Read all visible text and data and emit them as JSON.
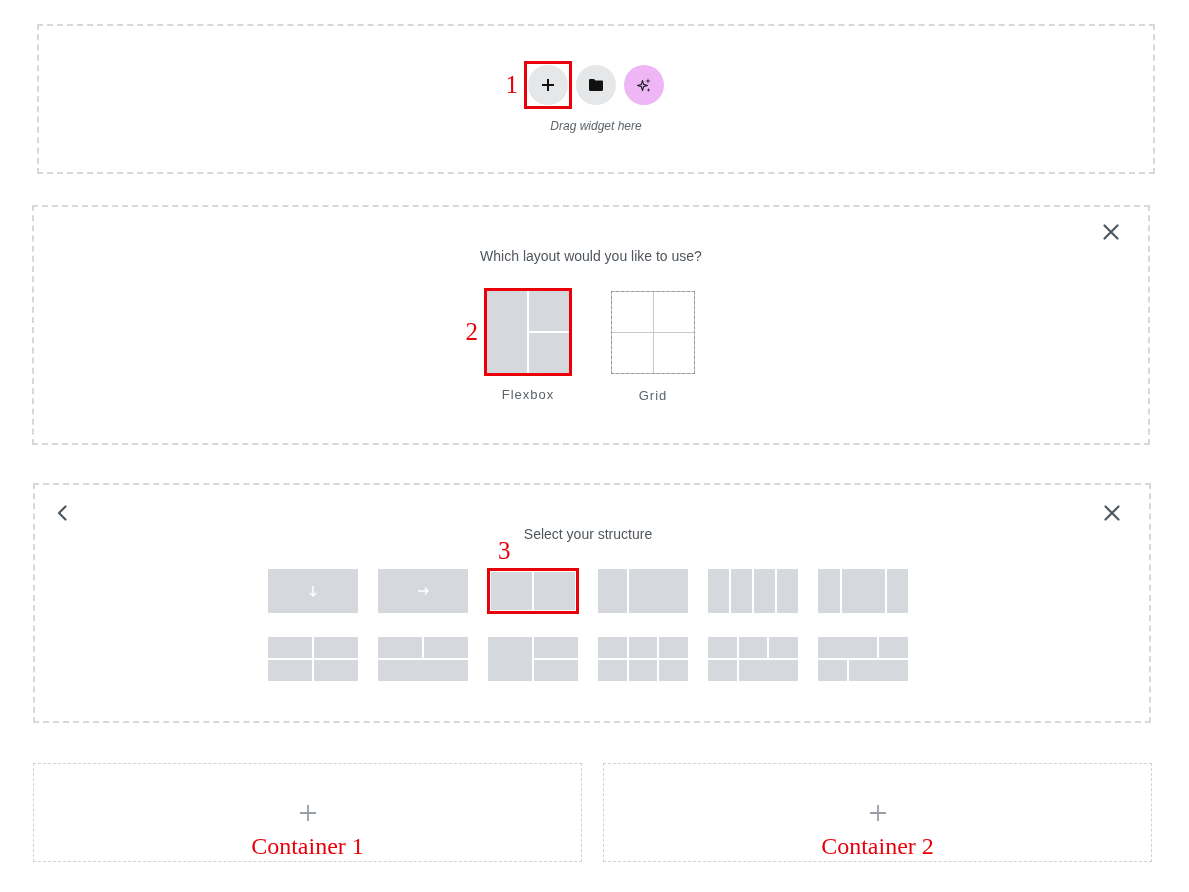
{
  "drop_zone": {
    "buttons": [
      {
        "kind": "add",
        "callout": "1"
      },
      {
        "kind": "templates"
      },
      {
        "kind": "ai"
      }
    ],
    "hint": "Drag widget here"
  },
  "layout_picker": {
    "title": "Which layout would you like to use?",
    "options": [
      {
        "kind": "flexbox",
        "label": "Flexbox",
        "callout": "2"
      },
      {
        "kind": "grid",
        "label": "Grid"
      }
    ]
  },
  "structure_picker": {
    "title": "Select your structure",
    "presets": [
      {
        "kind": "column"
      },
      {
        "kind": "row"
      },
      {
        "kind": "halves",
        "callout": "3"
      },
      {
        "kind": "one-third-left"
      },
      {
        "kind": "quarters"
      },
      {
        "kind": "wide-center"
      },
      {
        "kind": "grid-four"
      },
      {
        "kind": "top-split"
      },
      {
        "kind": "right-split"
      },
      {
        "kind": "grid-six"
      },
      {
        "kind": "three-over-two"
      },
      {
        "kind": "two-over-two"
      }
    ]
  },
  "containers": [
    {
      "label": "Container 1"
    },
    {
      "label": "Container 2"
    }
  ]
}
